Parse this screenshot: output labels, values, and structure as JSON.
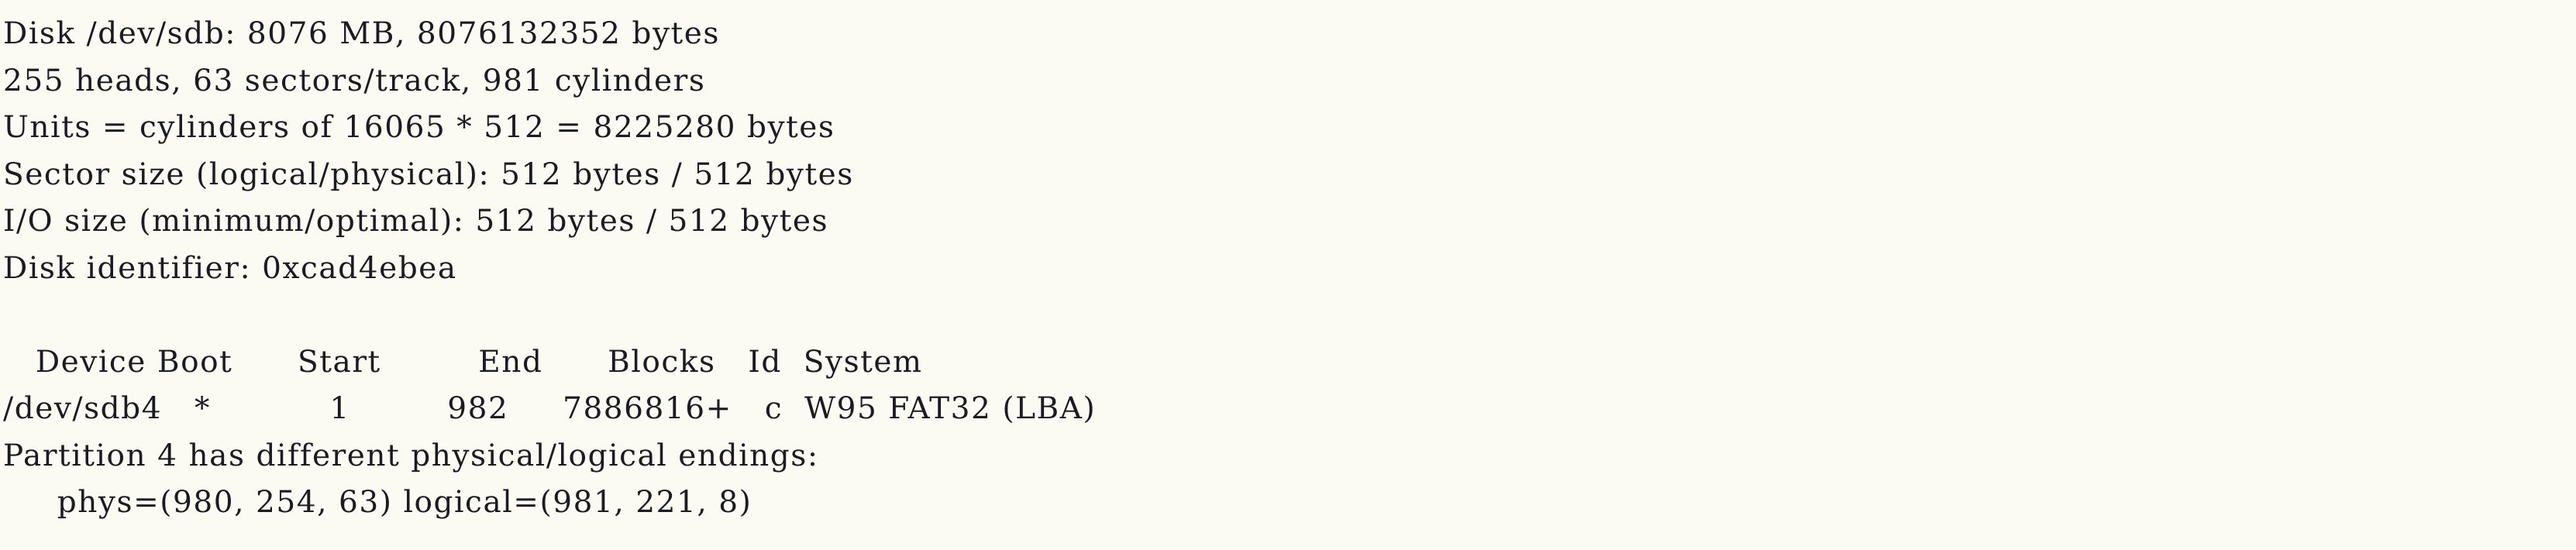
{
  "terminal": {
    "background_color": "#fbfaf3",
    "text_color": "#1b1b22",
    "device": "/dev/sdb",
    "lines": [
      {
        "id": "disk-summary",
        "text": "Disk /dev/sdb: 8076 MB, 8076132352 bytes"
      },
      {
        "id": "geometry",
        "text": "255 heads, 63 sectors/track, 981 cylinders"
      },
      {
        "id": "units",
        "text": "Units = cylinders of 16065 * 512 = 8225280 bytes"
      },
      {
        "id": "sector-size",
        "text": "Sector size (logical/physical): 512 bytes / 512 bytes"
      },
      {
        "id": "io-size",
        "text": "I/O size (minimum/optimal): 512 bytes / 512 bytes"
      },
      {
        "id": "disk-identifier",
        "text": "Disk identifier: 0xcad4ebea"
      },
      {
        "id": "spacer-1",
        "text": ""
      },
      {
        "id": "partition-table-header",
        "text": "   Device Boot      Start         End      Blocks   Id  System"
      },
      {
        "id": "partition-row-sdb4",
        "text": "/dev/sdb4   *           1         982     7886816+   c  W95 FAT32 (LBA)"
      },
      {
        "id": "warning-partition-4",
        "text": "Partition 4 has different physical/logical endings:"
      },
      {
        "id": "warning-chs-detail",
        "text": "     phys=(980, 254, 63) logical=(981, 221, 8)"
      }
    ],
    "disk_info": {
      "disk_label": "Disk",
      "disk_path": "/dev/sdb",
      "size_mb": "8076 MB",
      "size_bytes": "8076132352 bytes",
      "heads": "255",
      "heads_label": "heads",
      "sectors_per_track": "63",
      "sectors_label": "sectors/track",
      "cylinders": "981",
      "cylinders_label": "cylinders",
      "units_expr": "Units = cylinders of 16065 * 512 = 8225280 bytes",
      "units_multiplier": "16065",
      "units_sector_size": "512",
      "units_total": "8225280",
      "sector_size_logical": "512 bytes",
      "sector_size_physical": "512 bytes",
      "io_size_minimum": "512 bytes",
      "io_size_optimal": "512 bytes",
      "disk_identifier": "0xcad4ebea"
    },
    "partition_table": {
      "columns": [
        "Device",
        "Boot",
        "Start",
        "End",
        "Blocks",
        "Id",
        "System"
      ],
      "rows": [
        {
          "device": "/dev/sdb4",
          "boot": "*",
          "start": "1",
          "end": "982",
          "blocks": "7886816+",
          "id": "c",
          "system": "W95 FAT32 (LBA)"
        }
      ]
    },
    "warnings": [
      {
        "message": "Partition 4 has different physical/logical endings:",
        "phys": "phys=(980, 254, 63)",
        "logical": "logical=(981, 221, 8)",
        "phys_cylinder": "980",
        "phys_head": "254",
        "phys_sector": "63",
        "logical_cylinder": "981",
        "logical_head": "221",
        "logical_sector": "8"
      }
    ]
  }
}
